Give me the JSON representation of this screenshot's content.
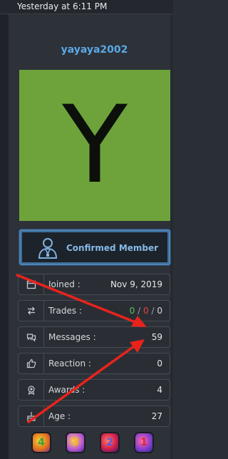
{
  "topbar": {
    "timestamp": "Yesterday at 6:11 PM"
  },
  "profile": {
    "username": "yayaya2002",
    "avatar_letter": "Y",
    "avatar_color": "#6ea33b",
    "banner_label": "Confirmed Member",
    "banner_icon": "member-badge-icon"
  },
  "stats": {
    "joined": {
      "label": "Joined :",
      "value": "Nov 9, 2019",
      "icon": "calendar-icon"
    },
    "trades": {
      "label": "Trades :",
      "positive": "0",
      "negative": "0",
      "neutral": "0",
      "sep": "/",
      "icon": "exchange-icon"
    },
    "messages": {
      "label": "Messages :",
      "value": "59",
      "icon": "chat-bubbles-icon"
    },
    "reaction": {
      "label": "Reaction :",
      "value": "0",
      "icon": "thumbs-up-icon"
    },
    "awards": {
      "label": "Awards :",
      "value": "4",
      "icon": "medal-icon"
    },
    "age": {
      "label": "Age :",
      "value": "27",
      "icon": "cake-icon"
    }
  },
  "award_badges": [
    "4",
    "3",
    "2",
    "1"
  ],
  "colors": {
    "username": "#5aa9e6",
    "trade_positive": "#58c25b",
    "trade_negative": "#e0473e",
    "annotation_arrow": "#e8231c"
  }
}
